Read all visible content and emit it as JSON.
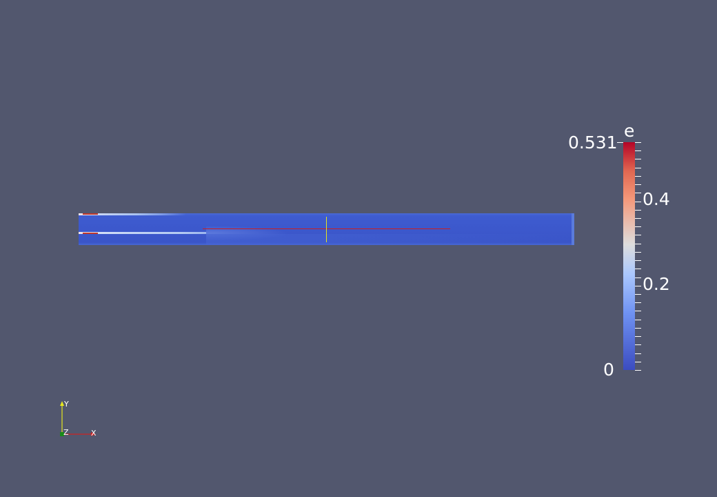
{
  "legend": {
    "title": "e",
    "max_label": "0.531",
    "ticks": [
      {
        "value": 0.4,
        "label": "0.4"
      },
      {
        "value": 0.2,
        "label": "0.2"
      },
      {
        "value": 0.0,
        "label": "0"
      }
    ],
    "range": [
      0,
      0.531
    ],
    "colormap": "cool-to-warm",
    "colors": {
      "low": "#3b4cc0",
      "mid": "#dddddd",
      "high": "#b40426"
    }
  },
  "axes": {
    "x_label": "X",
    "y_label": "Y",
    "z_label": "Z",
    "colors": {
      "x": "#cc2222",
      "y": "#e6e61e",
      "z": "#1a8a1a"
    }
  },
  "scene": {
    "background": "#52576e",
    "probe_line_color": "#cc1f1f",
    "probe_marker_color": "#e6e61e"
  }
}
